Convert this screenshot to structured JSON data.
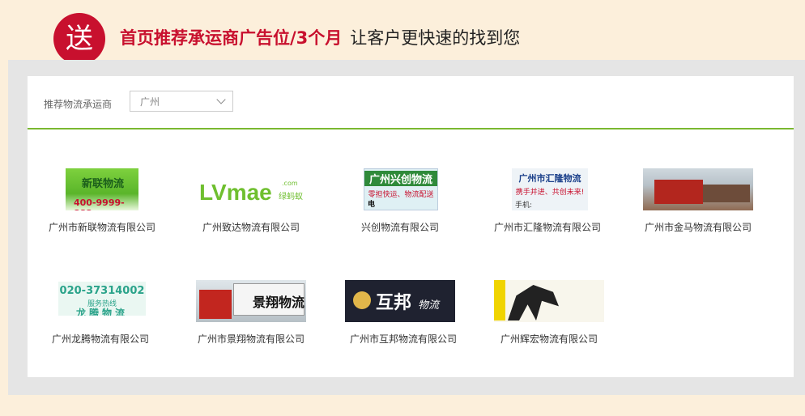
{
  "header": {
    "badge_char": "送",
    "headline_red": "首页推荐承运商广告位/3个月",
    "headline_black": "让客户更快速的找到您"
  },
  "filter": {
    "label": "推荐物流承运商",
    "city_value": "广州"
  },
  "companies": [
    {
      "name": "广州市新联物流有限公司",
      "logo_text": "新联物流",
      "logo_sub": "400-9999-883"
    },
    {
      "name": "广州致达物流有限公司",
      "logo_text": "LVmae",
      "logo_sub": "绿蚂蚁",
      "logo_domain": ".com"
    },
    {
      "name": "兴创物流有限公司",
      "logo_text": "广州兴创物流",
      "logo_sub": "零担快运、物流配送",
      "logo_phone": "电话:13798187519"
    },
    {
      "name": "广州市汇隆物流有限公司",
      "logo_text": "广州市汇隆物流",
      "logo_sub": "携手并进、共创未来!",
      "logo_phone": "手机:"
    },
    {
      "name": "广州市金马物流有限公司"
    },
    {
      "name": "广州龙腾物流有限公司",
      "logo_text": "020-37314002",
      "logo_sub": "服务热线",
      "logo_brand": "龙腾物流"
    },
    {
      "name": "广州市景翔物流有限公司",
      "logo_text": "景翔物流"
    },
    {
      "name": "广州市互邦物流有限公司",
      "logo_text": "互邦",
      "logo_sub": "物流"
    },
    {
      "name": "广州辉宏物流有限公司"
    }
  ],
  "colors": {
    "accent_red": "#c8102e",
    "divider_green": "#7ab830",
    "background": "#fcefdb"
  }
}
